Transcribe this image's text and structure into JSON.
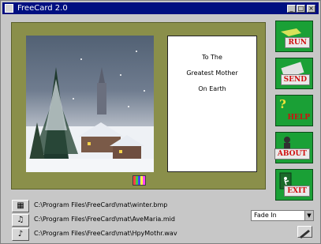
{
  "window": {
    "title": "FreeCard 2.0",
    "controls": [
      "minimize-icon",
      "maximize-icon",
      "close-icon"
    ]
  },
  "card": {
    "lines": [
      "To The",
      "Greatest Mother",
      "On Earth"
    ]
  },
  "side_buttons": [
    {
      "label": "RUN"
    },
    {
      "label": "SEND"
    },
    {
      "label": "HELP"
    },
    {
      "label": "ABOUT"
    },
    {
      "label": "EXIT"
    }
  ],
  "files": {
    "image": "C:\\Program Files\\FreeCard\\mat\\winter.bmp",
    "midi": "C:\\Program Files\\FreeCard\\mat\\AveMaria.mid",
    "wave": "C:\\Program Files\\FreeCard\\mat\\HpyMothr.wav"
  },
  "transition": {
    "value": "Fade In"
  },
  "colors": {
    "panel": "#8a8f4a",
    "button": "#1aa036",
    "button_text": "#d01010",
    "titlebar": "#000f80"
  }
}
